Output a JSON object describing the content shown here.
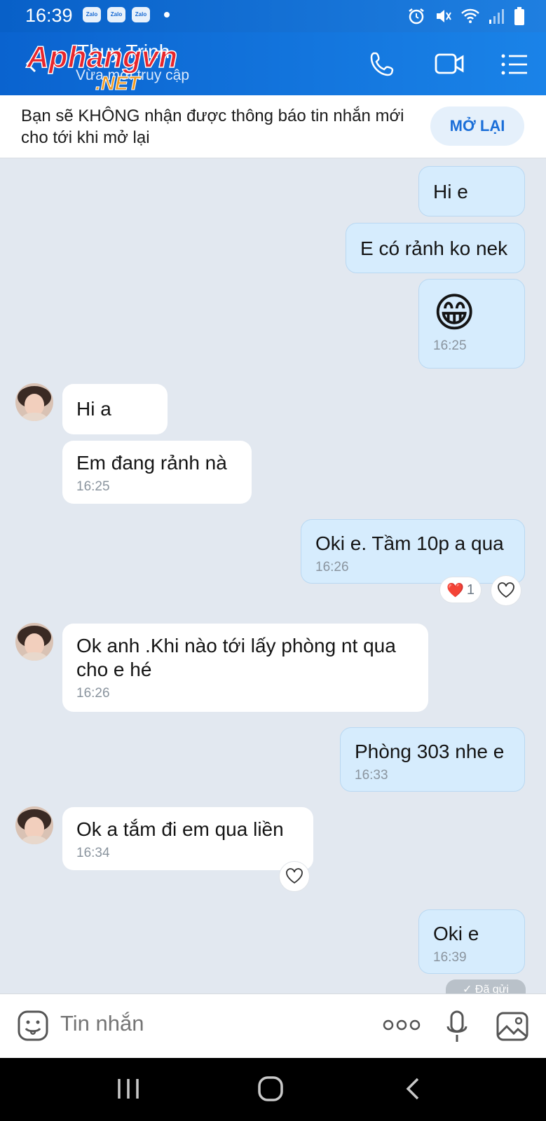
{
  "status_bar": {
    "time": "16:39",
    "notif_apps": [
      "Zalo",
      "Zalo",
      "Zalo"
    ]
  },
  "header": {
    "contact_name": "Thuy Trinh",
    "contact_status": "Vừa mới truy cập",
    "watermark": "Aphangvn",
    "watermark_suffix": ".NET"
  },
  "banner": {
    "text": "Bạn sẽ KHÔNG nhận được thông báo tin nhắn mới cho tới khi mở lại",
    "button": "MỞ LẠI"
  },
  "messages": [
    {
      "dir": "out",
      "text": "Hi e"
    },
    {
      "dir": "out",
      "text": "E có rảnh ko nek"
    },
    {
      "dir": "out",
      "emoji": "😁",
      "time": "16:25"
    },
    {
      "dir": "in",
      "text": "Hi a"
    },
    {
      "dir": "in",
      "text": "Em đang rảnh nà",
      "time": "16:25"
    },
    {
      "dir": "out",
      "text": "Oki e. Tầm 10p a qua",
      "time": "16:26",
      "reaction": "❤️",
      "reaction_count": "1"
    },
    {
      "dir": "in",
      "text": "Ok anh .Khi nào tới lấy phòng nt qua cho e hé",
      "time": "16:26"
    },
    {
      "dir": "out",
      "text": "Phòng 303 nhe e",
      "time": "16:33"
    },
    {
      "dir": "in",
      "text": "Ok a tắm đi em qua liền",
      "time": "16:34"
    },
    {
      "dir": "out",
      "text": "Oki e",
      "time": "16:39"
    }
  ],
  "sent_status": "✓ Đã gửi",
  "composer": {
    "placeholder": "Tin nhắn"
  },
  "colors": {
    "header": "#1a7be0",
    "out_bubble": "#d6ecfd",
    "in_bubble": "#ffffff",
    "chat_bg": "#e2e8f0"
  }
}
